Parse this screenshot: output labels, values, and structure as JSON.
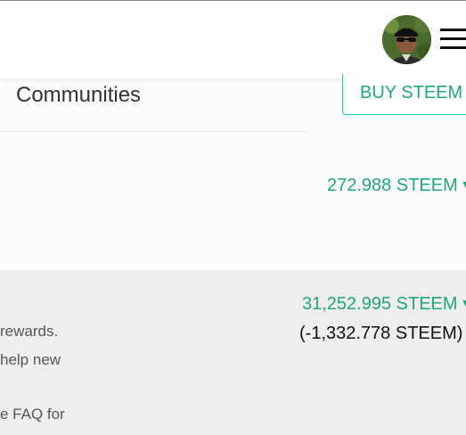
{
  "header": {
    "avatar_icon": "user-avatar-photo",
    "menu_icon": "hamburger-menu-icon"
  },
  "communities": {
    "title": "Communities"
  },
  "buy_button": {
    "label": "BUY STEEM"
  },
  "steem": {
    "balance": "272.988 STEEM ▾"
  },
  "steem_power": {
    "balance": "31,252.995 STEEM ▾",
    "delegated": "(-1,332.778 STEEM)",
    "description_lines": [
      "rewards.",
      "help new",
      "e FAQ for"
    ]
  },
  "colors": {
    "accent": "#1fa97a",
    "button_border": "#06d6a9",
    "gray_section": "#eeeeee"
  }
}
